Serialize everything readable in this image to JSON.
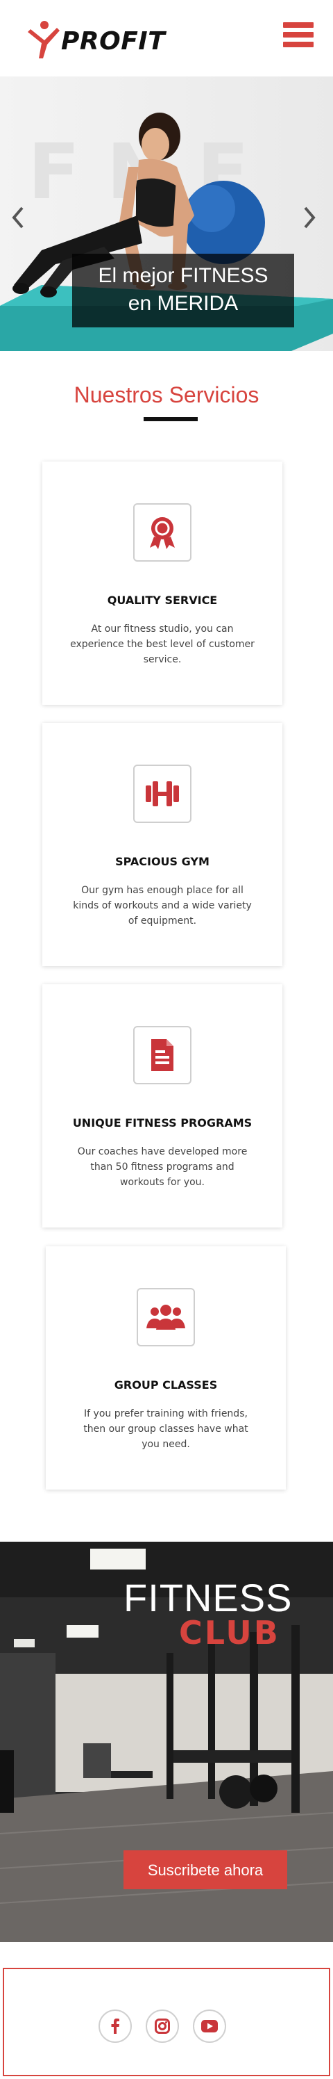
{
  "brand": {
    "name": "PROFIT",
    "accent": "#d7443e"
  },
  "header": {
    "menu_icon": "hamburger-menu-icon"
  },
  "hero": {
    "caption_line1": "El mejor FITNESS",
    "caption_line2": "en MERIDA",
    "prev_icon": "chevron-left-icon",
    "next_icon": "chevron-right-icon"
  },
  "services": {
    "title": "Nuestros Servicios",
    "items": [
      {
        "icon": "award-ribbon-icon",
        "title": "QUALITY SERVICE",
        "text": "At our fitness studio, you can experience the best level of customer service."
      },
      {
        "icon": "dumbbell-icon",
        "title": "SPACIOUS GYM",
        "text": "Our gym has enough place for all kinds of workouts and a wide variety of equipment."
      },
      {
        "icon": "document-icon",
        "title": "UNIQUE FITNESS PROGRAMS",
        "text": "Our coaches have developed more than 50 fitness programs and workouts for you."
      },
      {
        "icon": "group-users-icon",
        "title": "GROUP CLASSES",
        "text": "If you prefer training with friends, then our group classes have what you need."
      }
    ]
  },
  "gym_banner": {
    "title": "FITNESS",
    "subtitle": "CLUB",
    "button_label": "Suscribete ahora"
  },
  "footer": {
    "social": [
      "facebook-icon",
      "instagram-icon",
      "youtube-icon"
    ]
  }
}
